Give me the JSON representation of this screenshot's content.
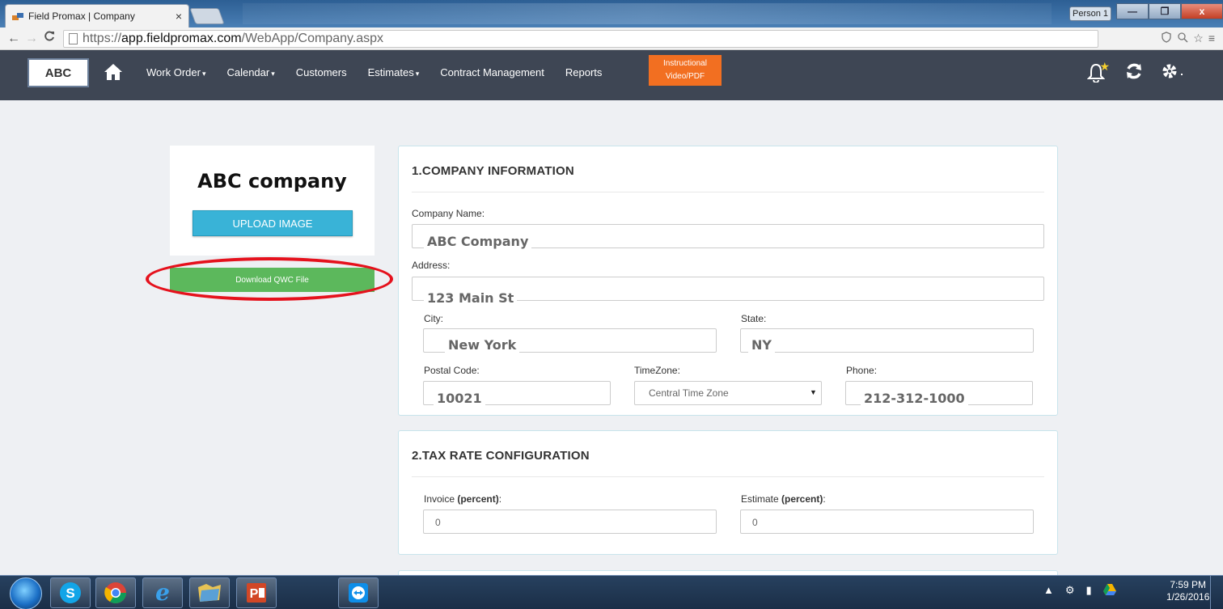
{
  "browser": {
    "tab_title": "Field Promax | Company",
    "tab_close": "×",
    "person_label": "Person 1",
    "url_scheme": "https://",
    "url_host": "app.fieldpromax.com",
    "url_path": "/WebApp/Company.aspx",
    "window_buttons": {
      "minimize": "—",
      "maximize": "❐",
      "close": "x"
    }
  },
  "navbar": {
    "logo": "ABC",
    "items": [
      {
        "label": "Work Order",
        "has_caret": true
      },
      {
        "label": "Calendar",
        "has_caret": true
      },
      {
        "label": "Customers",
        "has_caret": false
      },
      {
        "label": "Estimates",
        "has_caret": true
      },
      {
        "label": "Contract Management",
        "has_caret": false
      },
      {
        "label": "Reports",
        "has_caret": false
      }
    ],
    "caret": "▾",
    "instructional_line1": "Instructional",
    "instructional_line2": "Video/PDF",
    "accent_color": "#f26f21",
    "icons": [
      "home-icon",
      "bell-icon",
      "refresh-icon",
      "gear-icon"
    ]
  },
  "sidebar": {
    "company_name": "ABC company",
    "upload_label": "UPLOAD IMAGE",
    "download_label": "Download QWC File"
  },
  "company_info": {
    "title": "1.COMPANY INFORMATION",
    "company_name_label": "Company Name:",
    "company_name_value": "ABC Company",
    "address_label": "Address:",
    "address_value": "123 Main St",
    "city_label": "City:",
    "city_value": "New York",
    "state_label": "State:",
    "state_value": "NY",
    "postal_label": "Postal Code:",
    "postal_value": "10021",
    "timezone_label": "TimeZone:",
    "timezone_value": "Central Time Zone",
    "phone_label": "Phone:",
    "phone_value": "212-312-1000"
  },
  "tax": {
    "title": "2.TAX RATE CONFIGURATION",
    "invoice_label": "Invoice ",
    "invoice_label_bold": "(percent)",
    "invoice_value": "0",
    "estimate_label": "Estimate ",
    "estimate_label_bold": "(percent)",
    "estimate_value": "0",
    "colon": ":"
  },
  "taskbar": {
    "time": "7:59 PM",
    "date": "1/26/2016",
    "apps": [
      "skype",
      "chrome",
      "internet-explorer",
      "folder",
      "powerpoint",
      "teamviewer"
    ]
  }
}
